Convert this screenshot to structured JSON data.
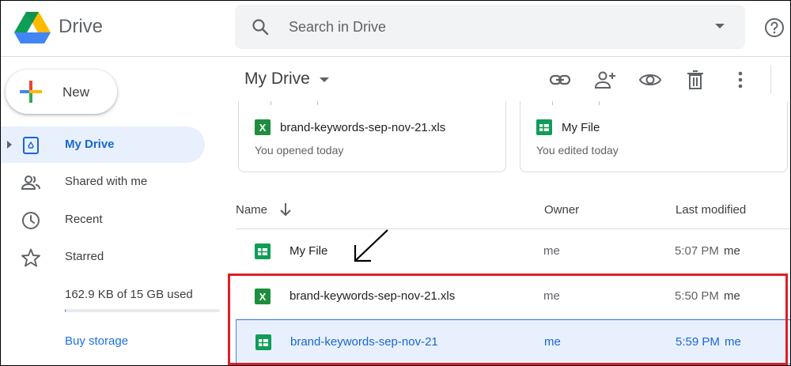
{
  "app": {
    "brand": "Drive",
    "accent": "#1a73e8"
  },
  "search": {
    "placeholder": "Search in Drive",
    "value": ""
  },
  "header_icons": {
    "search": "search-icon",
    "dropdown": "arrow-drop-down-icon",
    "help": "help-icon"
  },
  "sidebar": {
    "new_label": "New",
    "items": [
      {
        "label": "My Drive",
        "icon": "my-drive-icon",
        "active": true
      },
      {
        "label": "Shared with me",
        "icon": "people-icon",
        "active": false
      },
      {
        "label": "Recent",
        "icon": "clock-icon",
        "active": false
      },
      {
        "label": "Starred",
        "icon": "star-icon",
        "active": false
      }
    ],
    "storage_text": "162.9 KB of 15 GB used",
    "storage_used_fraction": 1e-05,
    "buy_storage_label": "Buy storage"
  },
  "main": {
    "title": "My Drive",
    "toolbar_icons": [
      "link-icon",
      "add-person-icon",
      "preview-eye-icon",
      "trash-icon",
      "more-vert-icon"
    ],
    "quick_access": [
      {
        "name": "brand-keywords-sep-nov-21.xls",
        "sub": "You opened today",
        "type": "excel"
      },
      {
        "name": "My File",
        "sub": "You edited today",
        "type": "sheets"
      }
    ],
    "columns": {
      "name": "Name",
      "owner": "Owner",
      "modified": "Last modified"
    },
    "files": [
      {
        "name": "My File",
        "owner": "me",
        "time": "5:07 PM",
        "by": "me",
        "type": "sheets",
        "selected": false
      },
      {
        "name": "brand-keywords-sep-nov-21.xls",
        "owner": "me",
        "time": "5:50 PM",
        "by": "me",
        "type": "excel",
        "selected": false
      },
      {
        "name": "brand-keywords-sep-nov-21",
        "owner": "me",
        "time": "5:59 PM",
        "by": "me",
        "type": "sheets",
        "selected": true
      }
    ]
  },
  "colors": {
    "selected_bg": "#e8f0fe",
    "selected_text": "#1967d2",
    "excel_green": "#1e8e3e",
    "sheets_green": "#0f9d58",
    "annotation_red": "#e01e25"
  }
}
